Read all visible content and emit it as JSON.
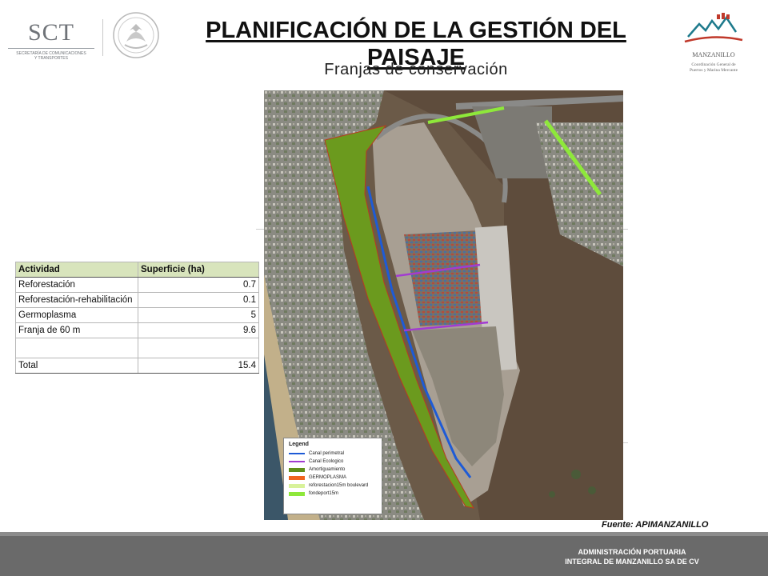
{
  "header": {
    "left_logo": {
      "name": "SCT",
      "line1": "SECRETARÍA DE COMUNICACIONES",
      "line2": "Y TRANSPORTES"
    },
    "right_logo": {
      "name": "MANZANILLO",
      "line1": "Coordinación General de",
      "line2": "Puertos y Marina Mercante"
    }
  },
  "title": {
    "line1": "PLANIFICACIÓN DE LA GESTIÓN DEL",
    "line2": "PAISAJE"
  },
  "subtitle": "Franjas de conservación",
  "table": {
    "headers": [
      "Actividad",
      "Superficie (ha)"
    ],
    "rows": [
      {
        "activity": "Reforestación",
        "area": "0.7"
      },
      {
        "activity": "Reforestación-rehabilitación",
        "area": "0.1"
      },
      {
        "activity": "Germoplasma",
        "area": "5"
      },
      {
        "activity": "Franja de 60 m",
        "area": "9.6"
      },
      {
        "activity": "",
        "area": ""
      }
    ],
    "total": {
      "activity": "Total",
      "area": "15.4"
    }
  },
  "map": {
    "legend": {
      "title": "Legend",
      "items": [
        {
          "label": "Canal perimetral",
          "color": "#1e5bd6",
          "kind": "line"
        },
        {
          "label": "Canal Ecologico",
          "color": "#a23bd1",
          "kind": "line"
        },
        {
          "label": "Amortiguamiento",
          "color": "#5f8f1a",
          "kind": "fill"
        },
        {
          "label": "GERMOPLASMA",
          "color": "#f0641e",
          "kind": "fill"
        },
        {
          "label": "reforestacion15m boulevard",
          "color": "#d8f29a",
          "kind": "fill"
        },
        {
          "label": "fondeport15m",
          "color": "#8ee83a",
          "kind": "fill"
        }
      ]
    }
  },
  "source": "Fuente: APIMANZANILLO",
  "footer": {
    "line1": "ADMINISTRACIÓN PORTUARIA",
    "line2": "INTEGRAL DE MANZANILLO SA DE CV"
  }
}
